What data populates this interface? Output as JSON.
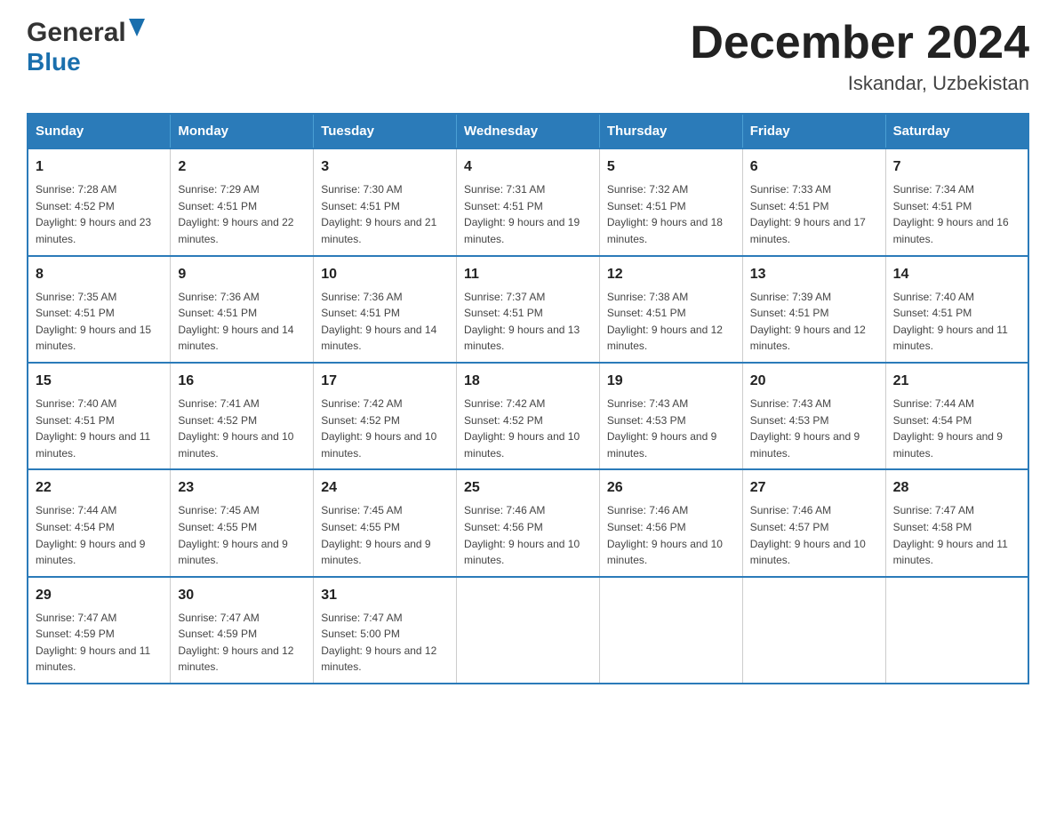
{
  "header": {
    "logo_general": "General",
    "logo_blue": "Blue",
    "month_title": "December 2024",
    "location": "Iskandar, Uzbekistan"
  },
  "calendar": {
    "days_of_week": [
      "Sunday",
      "Monday",
      "Tuesday",
      "Wednesday",
      "Thursday",
      "Friday",
      "Saturday"
    ],
    "weeks": [
      [
        {
          "day": "1",
          "sunrise": "Sunrise: 7:28 AM",
          "sunset": "Sunset: 4:52 PM",
          "daylight": "Daylight: 9 hours and 23 minutes."
        },
        {
          "day": "2",
          "sunrise": "Sunrise: 7:29 AM",
          "sunset": "Sunset: 4:51 PM",
          "daylight": "Daylight: 9 hours and 22 minutes."
        },
        {
          "day": "3",
          "sunrise": "Sunrise: 7:30 AM",
          "sunset": "Sunset: 4:51 PM",
          "daylight": "Daylight: 9 hours and 21 minutes."
        },
        {
          "day": "4",
          "sunrise": "Sunrise: 7:31 AM",
          "sunset": "Sunset: 4:51 PM",
          "daylight": "Daylight: 9 hours and 19 minutes."
        },
        {
          "day": "5",
          "sunrise": "Sunrise: 7:32 AM",
          "sunset": "Sunset: 4:51 PM",
          "daylight": "Daylight: 9 hours and 18 minutes."
        },
        {
          "day": "6",
          "sunrise": "Sunrise: 7:33 AM",
          "sunset": "Sunset: 4:51 PM",
          "daylight": "Daylight: 9 hours and 17 minutes."
        },
        {
          "day": "7",
          "sunrise": "Sunrise: 7:34 AM",
          "sunset": "Sunset: 4:51 PM",
          "daylight": "Daylight: 9 hours and 16 minutes."
        }
      ],
      [
        {
          "day": "8",
          "sunrise": "Sunrise: 7:35 AM",
          "sunset": "Sunset: 4:51 PM",
          "daylight": "Daylight: 9 hours and 15 minutes."
        },
        {
          "day": "9",
          "sunrise": "Sunrise: 7:36 AM",
          "sunset": "Sunset: 4:51 PM",
          "daylight": "Daylight: 9 hours and 14 minutes."
        },
        {
          "day": "10",
          "sunrise": "Sunrise: 7:36 AM",
          "sunset": "Sunset: 4:51 PM",
          "daylight": "Daylight: 9 hours and 14 minutes."
        },
        {
          "day": "11",
          "sunrise": "Sunrise: 7:37 AM",
          "sunset": "Sunset: 4:51 PM",
          "daylight": "Daylight: 9 hours and 13 minutes."
        },
        {
          "day": "12",
          "sunrise": "Sunrise: 7:38 AM",
          "sunset": "Sunset: 4:51 PM",
          "daylight": "Daylight: 9 hours and 12 minutes."
        },
        {
          "day": "13",
          "sunrise": "Sunrise: 7:39 AM",
          "sunset": "Sunset: 4:51 PM",
          "daylight": "Daylight: 9 hours and 12 minutes."
        },
        {
          "day": "14",
          "sunrise": "Sunrise: 7:40 AM",
          "sunset": "Sunset: 4:51 PM",
          "daylight": "Daylight: 9 hours and 11 minutes."
        }
      ],
      [
        {
          "day": "15",
          "sunrise": "Sunrise: 7:40 AM",
          "sunset": "Sunset: 4:51 PM",
          "daylight": "Daylight: 9 hours and 11 minutes."
        },
        {
          "day": "16",
          "sunrise": "Sunrise: 7:41 AM",
          "sunset": "Sunset: 4:52 PM",
          "daylight": "Daylight: 9 hours and 10 minutes."
        },
        {
          "day": "17",
          "sunrise": "Sunrise: 7:42 AM",
          "sunset": "Sunset: 4:52 PM",
          "daylight": "Daylight: 9 hours and 10 minutes."
        },
        {
          "day": "18",
          "sunrise": "Sunrise: 7:42 AM",
          "sunset": "Sunset: 4:52 PM",
          "daylight": "Daylight: 9 hours and 10 minutes."
        },
        {
          "day": "19",
          "sunrise": "Sunrise: 7:43 AM",
          "sunset": "Sunset: 4:53 PM",
          "daylight": "Daylight: 9 hours and 9 minutes."
        },
        {
          "day": "20",
          "sunrise": "Sunrise: 7:43 AM",
          "sunset": "Sunset: 4:53 PM",
          "daylight": "Daylight: 9 hours and 9 minutes."
        },
        {
          "day": "21",
          "sunrise": "Sunrise: 7:44 AM",
          "sunset": "Sunset: 4:54 PM",
          "daylight": "Daylight: 9 hours and 9 minutes."
        }
      ],
      [
        {
          "day": "22",
          "sunrise": "Sunrise: 7:44 AM",
          "sunset": "Sunset: 4:54 PM",
          "daylight": "Daylight: 9 hours and 9 minutes."
        },
        {
          "day": "23",
          "sunrise": "Sunrise: 7:45 AM",
          "sunset": "Sunset: 4:55 PM",
          "daylight": "Daylight: 9 hours and 9 minutes."
        },
        {
          "day": "24",
          "sunrise": "Sunrise: 7:45 AM",
          "sunset": "Sunset: 4:55 PM",
          "daylight": "Daylight: 9 hours and 9 minutes."
        },
        {
          "day": "25",
          "sunrise": "Sunrise: 7:46 AM",
          "sunset": "Sunset: 4:56 PM",
          "daylight": "Daylight: 9 hours and 10 minutes."
        },
        {
          "day": "26",
          "sunrise": "Sunrise: 7:46 AM",
          "sunset": "Sunset: 4:56 PM",
          "daylight": "Daylight: 9 hours and 10 minutes."
        },
        {
          "day": "27",
          "sunrise": "Sunrise: 7:46 AM",
          "sunset": "Sunset: 4:57 PM",
          "daylight": "Daylight: 9 hours and 10 minutes."
        },
        {
          "day": "28",
          "sunrise": "Sunrise: 7:47 AM",
          "sunset": "Sunset: 4:58 PM",
          "daylight": "Daylight: 9 hours and 11 minutes."
        }
      ],
      [
        {
          "day": "29",
          "sunrise": "Sunrise: 7:47 AM",
          "sunset": "Sunset: 4:59 PM",
          "daylight": "Daylight: 9 hours and 11 minutes."
        },
        {
          "day": "30",
          "sunrise": "Sunrise: 7:47 AM",
          "sunset": "Sunset: 4:59 PM",
          "daylight": "Daylight: 9 hours and 12 minutes."
        },
        {
          "day": "31",
          "sunrise": "Sunrise: 7:47 AM",
          "sunset": "Sunset: 5:00 PM",
          "daylight": "Daylight: 9 hours and 12 minutes."
        },
        {
          "day": "",
          "sunrise": "",
          "sunset": "",
          "daylight": ""
        },
        {
          "day": "",
          "sunrise": "",
          "sunset": "",
          "daylight": ""
        },
        {
          "day": "",
          "sunrise": "",
          "sunset": "",
          "daylight": ""
        },
        {
          "day": "",
          "sunrise": "",
          "sunset": "",
          "daylight": ""
        }
      ]
    ]
  }
}
